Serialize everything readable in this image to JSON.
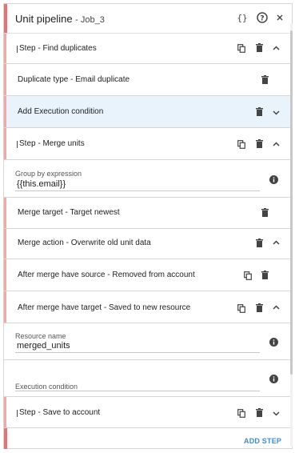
{
  "header": {
    "title": "Unit pipeline",
    "subtitle": "- Job_3"
  },
  "rows": [
    {
      "label": "Step - Find duplicates"
    },
    {
      "label": "Duplicate type - Email duplicate"
    },
    {
      "label": "Add Execution condition"
    },
    {
      "label": "Step - Merge units"
    },
    {
      "label": "Merge target - Target newest"
    },
    {
      "label": "Merge action - Overwrite old unit data"
    },
    {
      "label": "After merge have source - Removed from account"
    },
    {
      "label": "After merge have target - Saved to new resource"
    },
    {
      "label": "Step - Save to account"
    }
  ],
  "fields": {
    "group_by": {
      "label": "Group by expression",
      "value": "{{this.email}}"
    },
    "resource_name": {
      "label": "Resource name",
      "value": "merged_units"
    },
    "execution_condition": {
      "label": "Execution condition",
      "value": ""
    }
  },
  "footer": {
    "add_step": "ADD STEP"
  },
  "colors": {
    "accent": "#e57373",
    "accent_light": "#f2a7a7",
    "highlight": "#e9f3fb",
    "link": "#3c8dd8"
  },
  "icons": [
    "braces-icon",
    "help-icon",
    "close-icon",
    "copy-icon",
    "trash-icon",
    "chevron-up-icon",
    "chevron-down-icon",
    "info-icon",
    "drag-handle-icon"
  ]
}
